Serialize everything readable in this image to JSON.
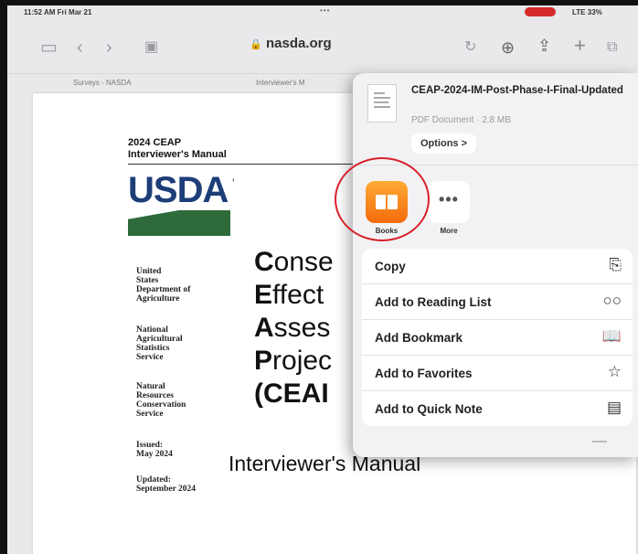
{
  "status_bar": {
    "time": "11:52 AM  Fri Mar 21",
    "network": "LTE 33%"
  },
  "browser": {
    "url": "nasda.org",
    "tabs": [
      "Surveys - NASDA",
      "Interviewer's M"
    ]
  },
  "document": {
    "header_lines": [
      "2024 CEAP",
      "Interviewer's Manual"
    ],
    "logo_text": "USDA",
    "agencies": [
      [
        "United",
        "States",
        "Department of",
        "Agriculture"
      ],
      [
        "National",
        "Agricultural",
        "Statistics",
        "Service"
      ],
      [
        "Natural",
        "Resources",
        "Conservation",
        "Service"
      ],
      [
        "Issued:",
        "May 2024"
      ],
      [
        "Updated:",
        "September 2024"
      ]
    ],
    "title_lines": [
      {
        "initial": "C",
        "rest": "onse"
      },
      {
        "initial": "E",
        "rest": "ffect"
      },
      {
        "initial": "A",
        "rest": "sses"
      },
      {
        "initial": "P",
        "rest": "rojec"
      },
      {
        "initial": "",
        "rest": "(CEAI"
      }
    ],
    "subtitle": "Interviewer's Manual"
  },
  "share_sheet": {
    "file_name": "CEAP-2024-IM-Post-Phase-I-Final-Updated",
    "file_meta": "PDF Document · 2.8 MB",
    "options_label": "Options >",
    "apps": [
      {
        "label": "Books",
        "icon": "books-app-icon"
      },
      {
        "label": "More",
        "icon": "more-dots-icon"
      }
    ],
    "actions": [
      {
        "label": "Copy",
        "icon": "⎘"
      },
      {
        "label": "Add to Reading List",
        "icon": "○○"
      },
      {
        "label": "Add Bookmark",
        "icon": "📖"
      },
      {
        "label": "Add to Favorites",
        "icon": "☆"
      },
      {
        "label": "Add to Quick Note",
        "icon": "▤"
      }
    ]
  },
  "colors": {
    "usda_blue": "#1d3e78",
    "usda_green": "#2f6b3a",
    "books_orange": "#f36b0d",
    "annotation_red": "#d8202a"
  }
}
